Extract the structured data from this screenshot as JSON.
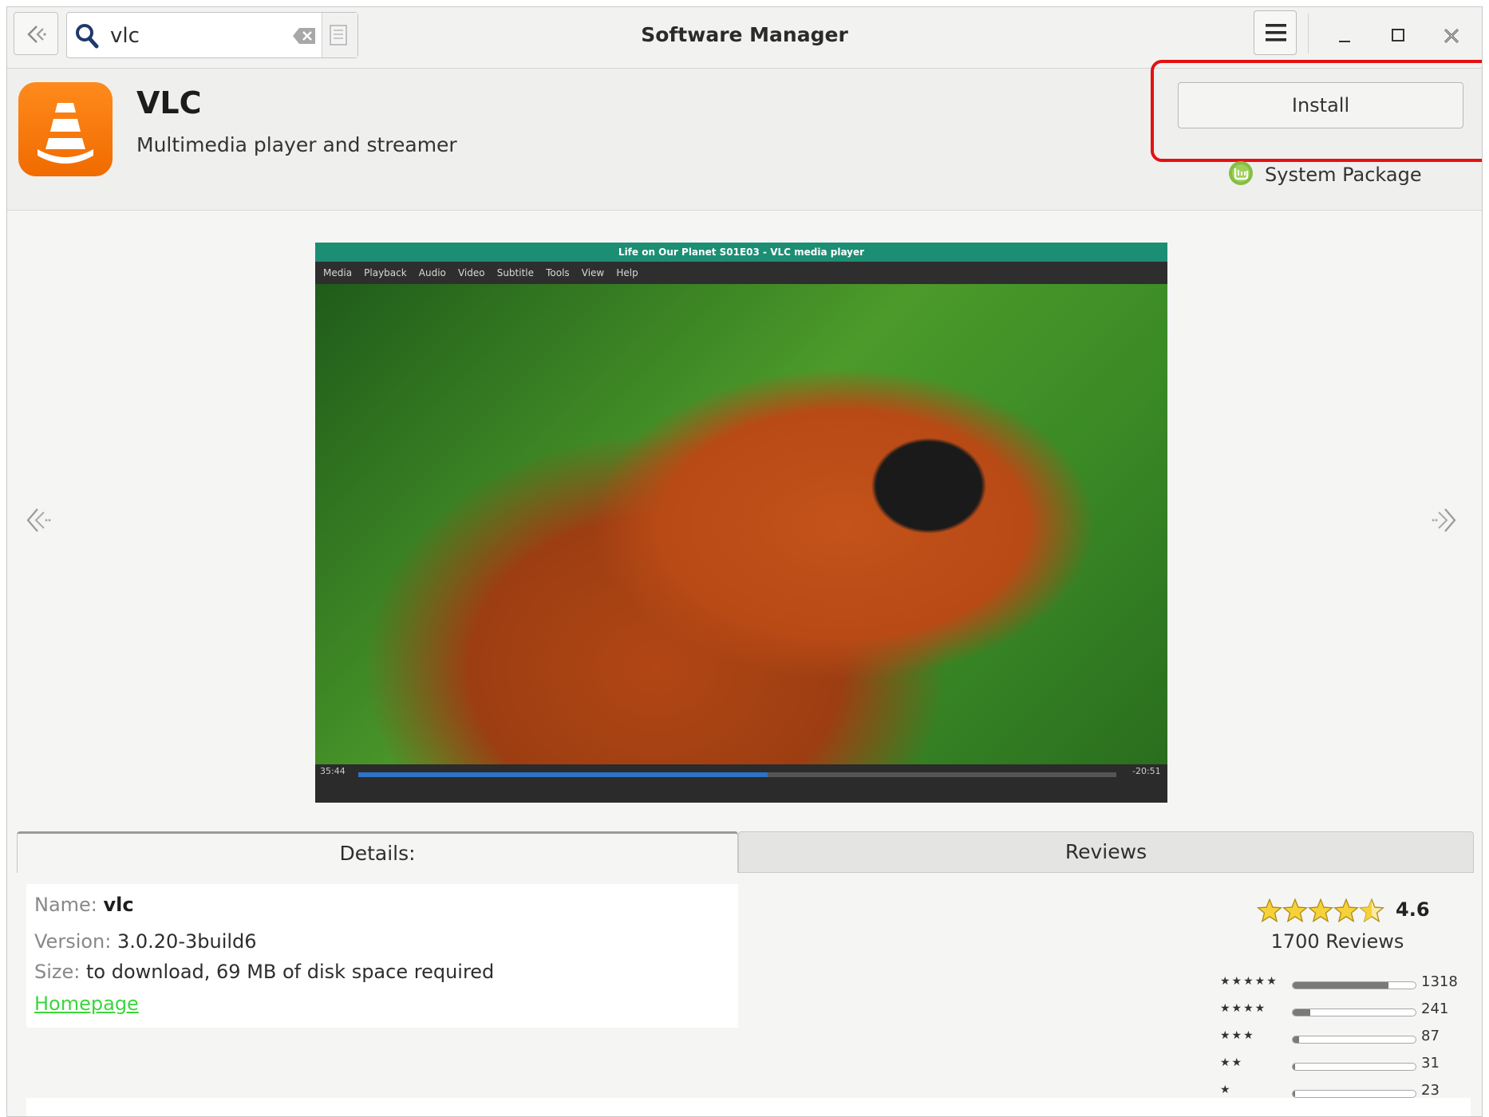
{
  "window": {
    "title": "Software Manager"
  },
  "search": {
    "value": "vlc",
    "placeholder": ""
  },
  "app": {
    "name": "VLC",
    "summary": "Multimedia player and streamer",
    "install_label": "Install",
    "package_type": "System Package"
  },
  "screenshot": {
    "window_title": "Life on Our Planet S01E03 - VLC media player",
    "menu": [
      "Media",
      "Playback",
      "Audio",
      "Video",
      "Subtitle",
      "Tools",
      "View",
      "Help"
    ],
    "time_elapsed": "35:44",
    "time_remaining": "-20:51",
    "progress": 0.54
  },
  "tabs": {
    "details": "Details:",
    "reviews": "Reviews"
  },
  "details": {
    "name_key": "Name:",
    "name_value": "vlc",
    "version_key": "Version:",
    "version_value": "3.0.20-3build6",
    "size_key": "Size:",
    "size_value": "to download, 69 MB of disk space required",
    "homepage_label": "Homepage"
  },
  "rating": {
    "score": "4.6",
    "reviews_text": "1700 Reviews",
    "breakdown": [
      {
        "stars": "★★★★★",
        "count": "1318",
        "fraction": 0.78
      },
      {
        "stars": "★★★★",
        "count": "241",
        "fraction": 0.14
      },
      {
        "stars": "★★★",
        "count": "87",
        "fraction": 0.05
      },
      {
        "stars": "★★",
        "count": "31",
        "fraction": 0.02
      },
      {
        "stars": "★",
        "count": "23",
        "fraction": 0.014
      }
    ]
  },
  "colors": {
    "install_highlight": "#e51010",
    "homepage_link": "#3cd63c",
    "vlc_orange": "#f07a00",
    "mint_green": "#86be43"
  }
}
